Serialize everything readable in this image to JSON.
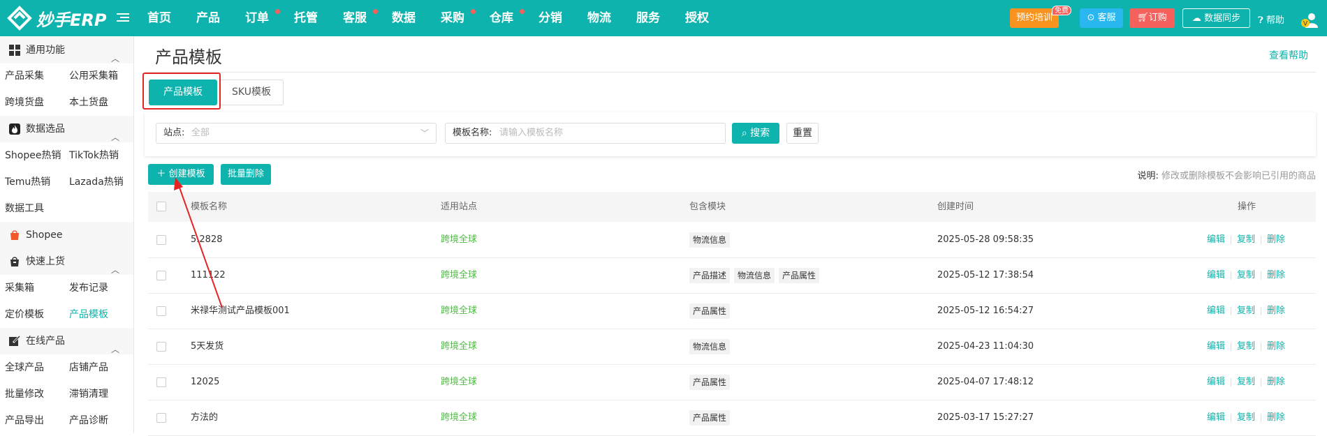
{
  "header": {
    "logo_text": "妙手ERP",
    "nav": [
      {
        "label": "首页",
        "dot": false
      },
      {
        "label": "产品",
        "dot": false
      },
      {
        "label": "订单",
        "dot": true
      },
      {
        "label": "托管",
        "dot": false
      },
      {
        "label": "客服",
        "dot": true
      },
      {
        "label": "数据",
        "dot": false
      },
      {
        "label": "采购",
        "dot": true
      },
      {
        "label": "仓库",
        "dot": true
      },
      {
        "label": "分销",
        "dot": false
      },
      {
        "label": "物流",
        "dot": false
      },
      {
        "label": "服务",
        "dot": false
      },
      {
        "label": "授权",
        "dot": false
      }
    ],
    "training_label": "预约培训",
    "free_badge": "免费",
    "service_label": "客服",
    "order_label": "订购",
    "sync_label": "数据同步",
    "help_label": "帮助",
    "avatar_badge": "V"
  },
  "sidebar": {
    "sections": [
      {
        "label": "通用功能",
        "icon": "grid-icon"
      },
      {
        "label": "数据选品",
        "icon": "fire-icon"
      },
      {
        "label": "Shopee",
        "icon": "shopee-bag-icon"
      },
      {
        "label": "快速上货",
        "icon": "shopping-bag-icon"
      },
      {
        "label": "在线产品",
        "icon": "edit-icon"
      }
    ],
    "links": {
      "product_collect": "产品采集",
      "public_collect_box": "公用采集箱",
      "cross_border_inventory": "跨境货盘",
      "local_inventory": "本土货盘",
      "shopee_hot": "Shopee热销",
      "tiktok_hot": "TikTok热销",
      "temu_hot": "Temu热销",
      "lazada_hot": "Lazada热销",
      "data_tools": "数据工具",
      "collect_box": "采集箱",
      "publish_records": "发布记录",
      "pricing_template": "定价模板",
      "product_template": "产品模板",
      "global_products": "全球产品",
      "store_products": "店铺产品",
      "bulk_edit": "批量修改",
      "slow_sales_cleanup": "滞销清理",
      "product_export": "产品导出",
      "product_diagnosis": "产品诊断"
    }
  },
  "main": {
    "title": "产品模板",
    "help_link": "查看帮助",
    "tabs": [
      "产品模板",
      "SKU模板"
    ],
    "filter": {
      "site_label": "站点:",
      "site_value": "全部",
      "name_label": "模板名称:",
      "name_placeholder": "请输入模板名称",
      "search_label": "搜索",
      "reset_label": "重置"
    },
    "actions": {
      "create_label": "创建模板",
      "bulk_delete_label": "批量删除"
    },
    "note_key": "说明:",
    "note_value": "修改或删除模板不会影响已引用的商品",
    "table": {
      "columns": [
        "模板名称",
        "适用站点",
        "包含模块",
        "创建时间",
        "操作"
      ],
      "rows": [
        {
          "name": "5.2828",
          "site": "跨境全球",
          "modules": [
            "物流信息"
          ],
          "created": "2025-05-28 09:58:35"
        },
        {
          "name": "111122",
          "site": "跨境全球",
          "modules": [
            "产品描述",
            "物流信息",
            "产品属性"
          ],
          "created": "2025-05-12 17:38:54"
        },
        {
          "name": "米禄华测试产品模板001",
          "site": "跨境全球",
          "modules": [
            "产品属性"
          ],
          "created": "2025-05-12 16:54:27"
        },
        {
          "name": "5天发货",
          "site": "跨境全球",
          "modules": [
            "物流信息"
          ],
          "created": "2025-04-23 11:04:30"
        },
        {
          "name": "12025",
          "site": "跨境全球",
          "modules": [
            "产品属性"
          ],
          "created": "2025-04-07 17:48:12"
        },
        {
          "name": "方法的",
          "site": "跨境全球",
          "modules": [
            "产品属性"
          ],
          "created": "2025-03-17 15:27:27"
        }
      ],
      "ops": [
        "编辑",
        "复制",
        "删除"
      ]
    }
  },
  "colors": {
    "brand": "#0fb3ad",
    "site_green": "#52b948",
    "highlight_red": "#e52424"
  }
}
